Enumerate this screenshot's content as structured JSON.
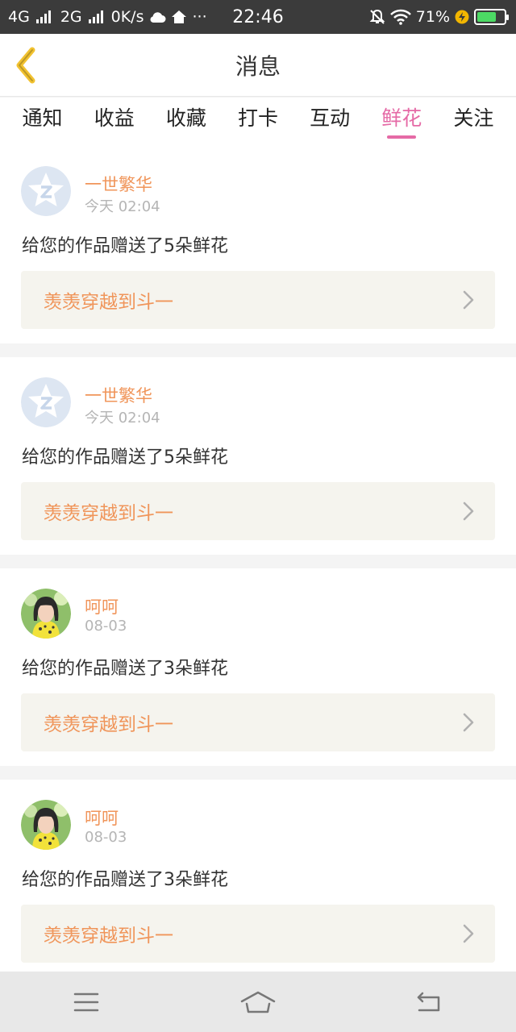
{
  "status_bar": {
    "network_1": "4G",
    "network_2": "2G",
    "speed": "0K/s",
    "more": "···",
    "time": "22:46",
    "battery_percent": "71%",
    "battery_level": 0.71,
    "battery_color": "#4cd964"
  },
  "header": {
    "title": "消息",
    "back_icon": "chevron-left-icon",
    "accent_color": "#f2c230"
  },
  "tabs": [
    {
      "label": "通知",
      "active": false
    },
    {
      "label": "收益",
      "active": false
    },
    {
      "label": "收藏",
      "active": false
    },
    {
      "label": "打卡",
      "active": false
    },
    {
      "label": "互动",
      "active": false
    },
    {
      "label": "鲜花",
      "active": true
    },
    {
      "label": "关注",
      "active": false
    }
  ],
  "active_tab_color": "#e56aa6",
  "messages": [
    {
      "user": "一世繁华",
      "time": "今天 02:04",
      "text": "给您的作品赠送了5朵鲜花",
      "link": "羡羡穿越到斗一",
      "avatar": "default-avatar"
    },
    {
      "user": "一世繁华",
      "time": "今天 02:04",
      "text": "给您的作品赠送了5朵鲜花",
      "link": "羡羡穿越到斗一",
      "avatar": "default-avatar"
    },
    {
      "user": "呵呵",
      "time": "08-03",
      "text": "给您的作品赠送了3朵鲜花",
      "link": "羡羡穿越到斗一",
      "avatar": "photo-avatar"
    },
    {
      "user": "呵呵",
      "time": "08-03",
      "text": "给您的作品赠送了3朵鲜花",
      "link": "羡羡穿越到斗一",
      "avatar": "photo-avatar"
    }
  ],
  "nav_bar": {
    "menu_icon": "menu-icon",
    "home_icon": "home-icon",
    "back_icon": "back-icon"
  }
}
